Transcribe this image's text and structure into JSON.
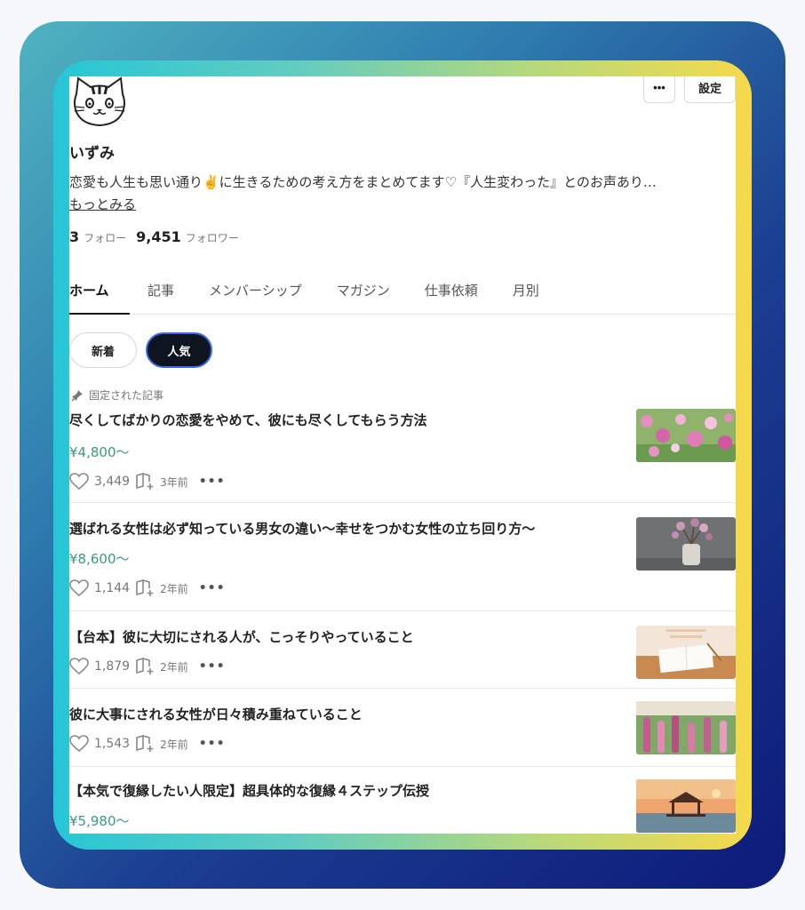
{
  "profile": {
    "name": "いずみ",
    "bio": "恋愛も人生も思い通り✌️に生きるための考え方をまとめてます♡『人生変わった』とのお声あり…",
    "more_link": "もっとみる",
    "follow_count": "3",
    "follow_label": "フォロー",
    "follower_count": "9,451",
    "follower_label": "フォロワー"
  },
  "header": {
    "more_label": "•••",
    "settings_label": "設定"
  },
  "tabs": [
    {
      "label": "ホーム",
      "active": true
    },
    {
      "label": "記事"
    },
    {
      "label": "メンバーシップ"
    },
    {
      "label": "マガジン"
    },
    {
      "label": "仕事依頼"
    },
    {
      "label": "月別"
    }
  ],
  "filters": {
    "new_label": "新着",
    "popular_label": "人気"
  },
  "pinned_label": "固定された記事",
  "articles": [
    {
      "title": "尽くしてばかりの恋愛をやめて、彼にも尽くしてもらう方法",
      "price": "¥4,800〜",
      "likes": "3,449",
      "time": "3年前",
      "thumb": "pink-flowers"
    },
    {
      "title": "選ばれる女性は必ず知っている男女の違い〜幸せをつかむ女性の立ち回り方〜",
      "price": "¥8,600〜",
      "likes": "1,144",
      "time": "2年前",
      "thumb": "vase"
    },
    {
      "title": "【台本】彼に大切にされる人が、こっそりやっていること",
      "price": "",
      "likes": "1,879",
      "time": "2年前",
      "thumb": "notebook"
    },
    {
      "title": "彼に大事にされる女性が日々積み重ねていること",
      "price": "",
      "likes": "1,543",
      "time": "2年前",
      "thumb": "foxglove"
    },
    {
      "title": "【本気で復縁したい人限定】超具体的な復縁４ステップ伝授",
      "price": "¥5,980〜",
      "likes": "",
      "time": "",
      "thumb": "sunset-gazebo"
    }
  ],
  "colors": {
    "price_green": "#3a9a7a",
    "active_filter_bg": "#0e1520",
    "active_filter_border": "#3a6ae6"
  }
}
